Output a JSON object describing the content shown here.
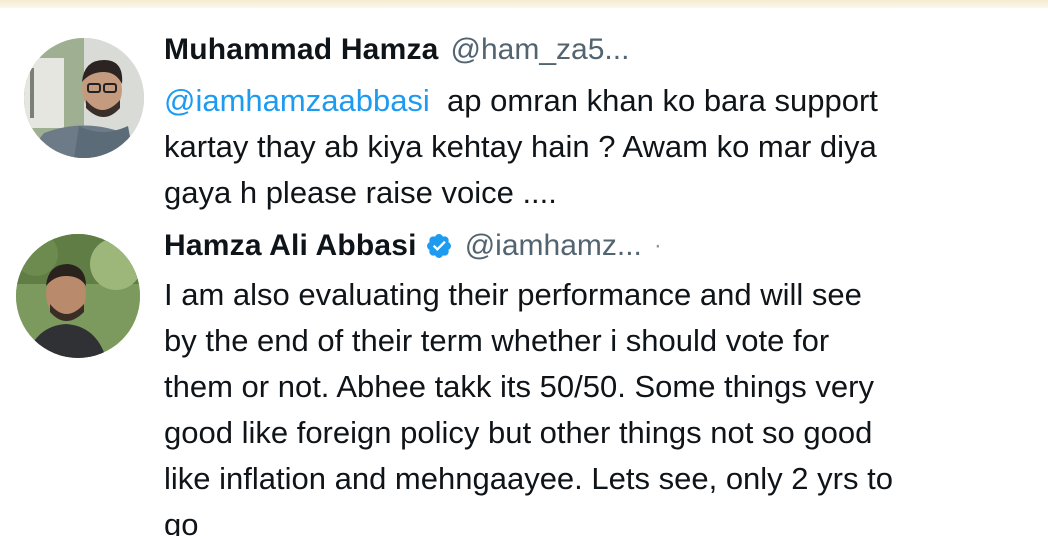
{
  "tweets": [
    {
      "display_name": "Muhammad Hamza",
      "handle": "@ham_za5...",
      "verified": false,
      "mention": "@iamhamzaabbasi",
      "text_line_1": "  ap omran khan ko bara support",
      "text_line_2": "kartay thay ab kiya kehtay hain ? Awam ko mar diya",
      "text_line_3": "gaya h please raise voice ....",
      "avatar_icon": "profile-photo"
    },
    {
      "display_name": "Hamza Ali Abbasi",
      "handle": "@iamhamz...",
      "separator": "·",
      "verified": true,
      "verified_icon": "verified-badge-icon",
      "text_lines": [
        "I am also evaluating their performance and will see",
        "by the end of their term whether i should vote for",
        "them or not. Abhee takk its 50/50. Some things very",
        "good like foreign policy but other things not so good",
        "like inflation and mehngaayee. Lets see, only 2 yrs to",
        "go"
      ],
      "avatar_icon": "profile-photo"
    }
  ],
  "colors": {
    "text": "#0f1419",
    "secondary": "#536471",
    "link": "#1d9bf0",
    "verified": "#1d9bf0"
  }
}
